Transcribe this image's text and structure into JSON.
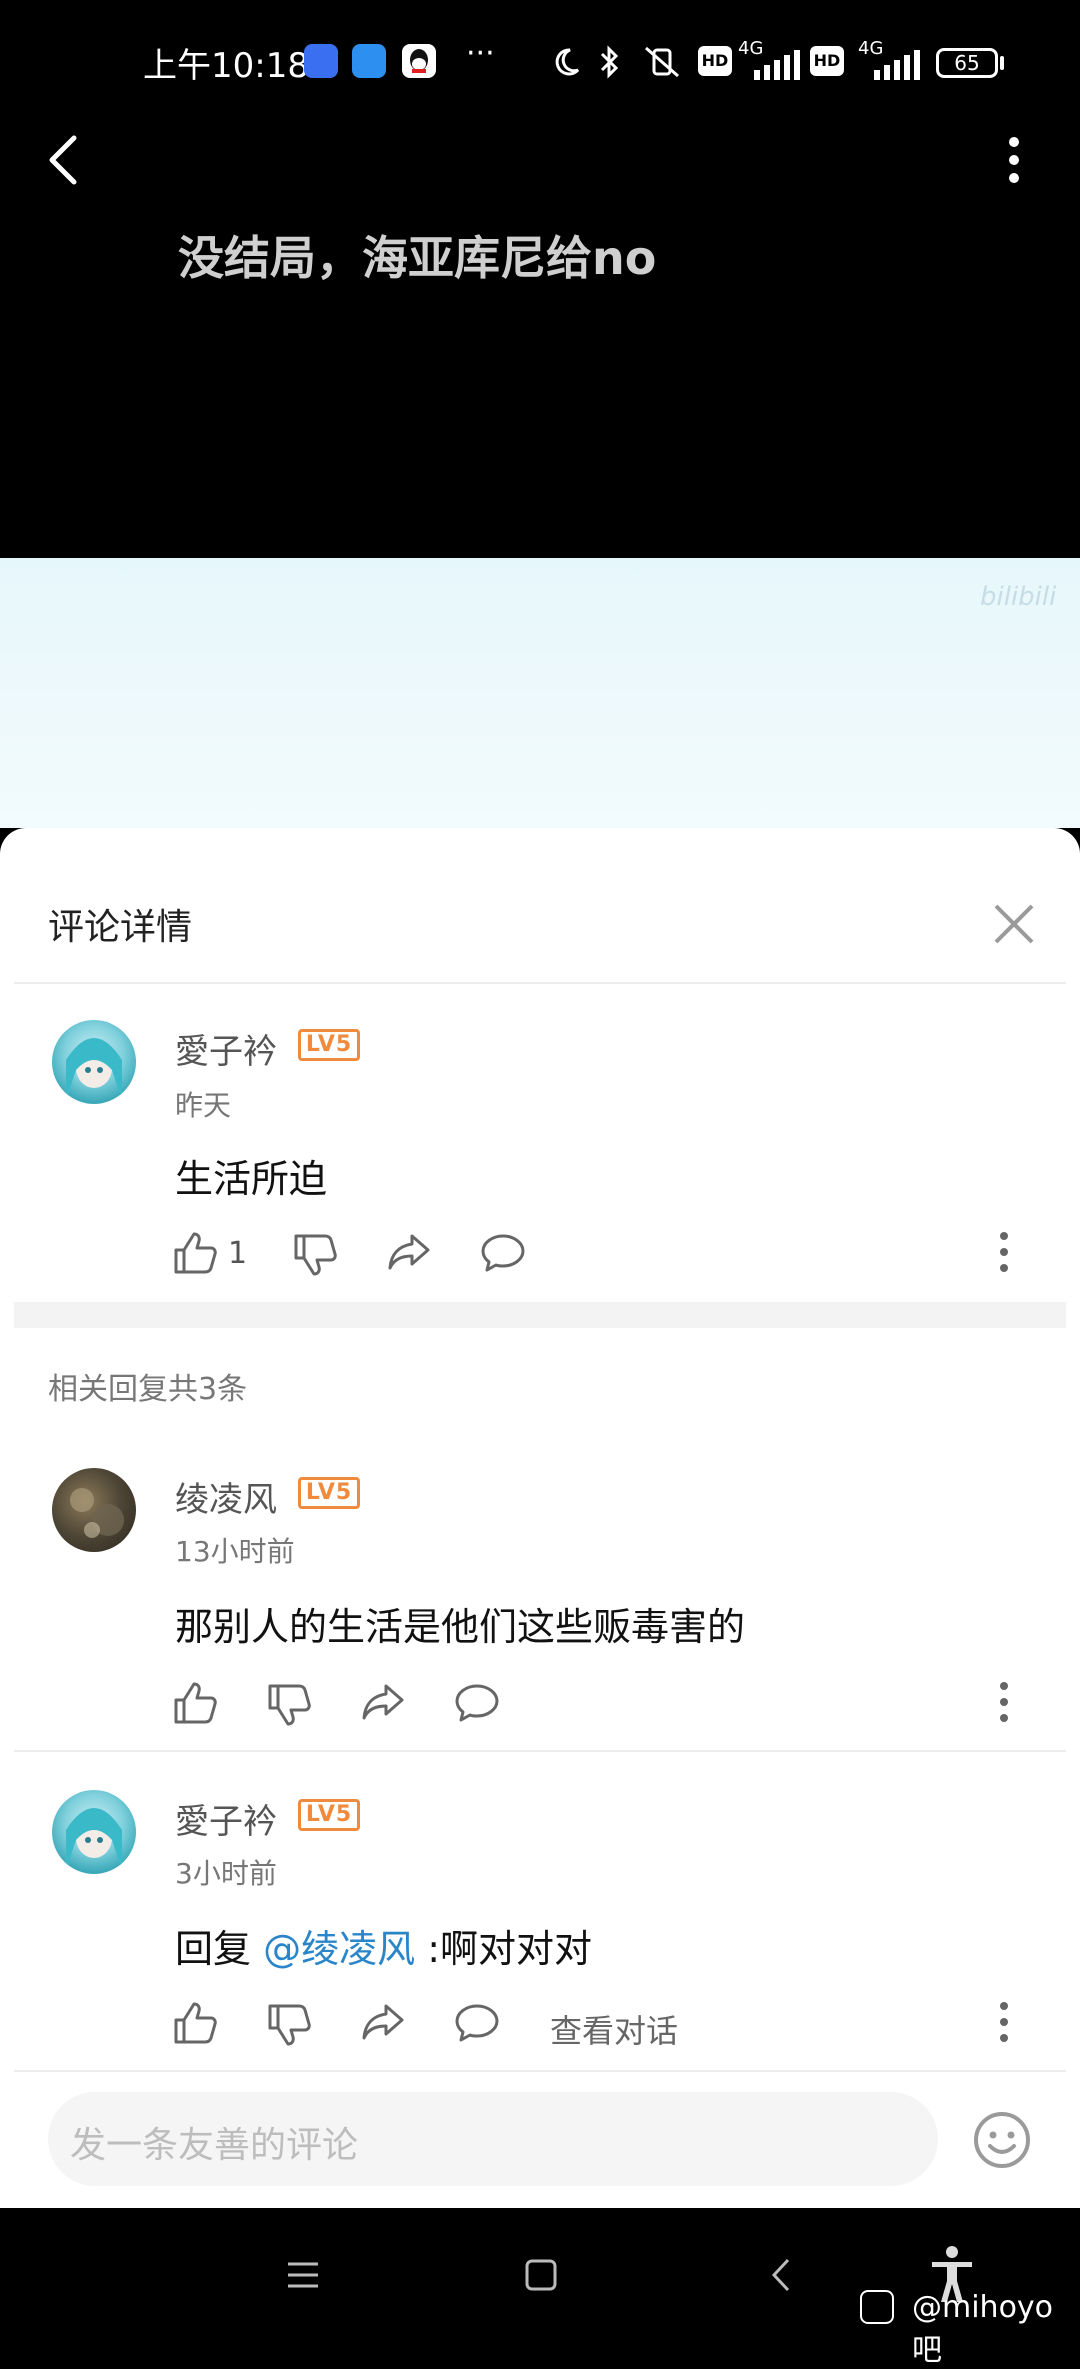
{
  "status_bar": {
    "time": "上午10:18",
    "battery": "65",
    "network_1": "4G",
    "network_2": "4G",
    "hd_1": "HD",
    "hd_2": "HD",
    "more": "···"
  },
  "video": {
    "subtitle": "没结局，海亚库尼给no",
    "watermark": "bilibili"
  },
  "sheet": {
    "title": "评论详情"
  },
  "main_comment": {
    "username": "愛子衿",
    "level": "LV5",
    "time": "昨天",
    "text": "生活所迫",
    "like_count": "1"
  },
  "replies_header": "相关回复共3条",
  "replies": [
    {
      "username": "绫凌风",
      "level": "LV5",
      "time": "13小时前",
      "text": "那别人的生活是他们这些贩毒害的"
    },
    {
      "username": "愛子衿",
      "level": "LV5",
      "time": "3小时前",
      "reply_prefix": "回复 ",
      "mention": "@绫凌风",
      "text_after": " :啊对对对",
      "view_conversation": "查看对话"
    }
  ],
  "composer": {
    "placeholder": "发一条友善的评论"
  },
  "watermark_tieba": "@mihoyo吧",
  "colors": {
    "accent_link": "#2a86c9",
    "level_badge": "#f08a3c"
  }
}
